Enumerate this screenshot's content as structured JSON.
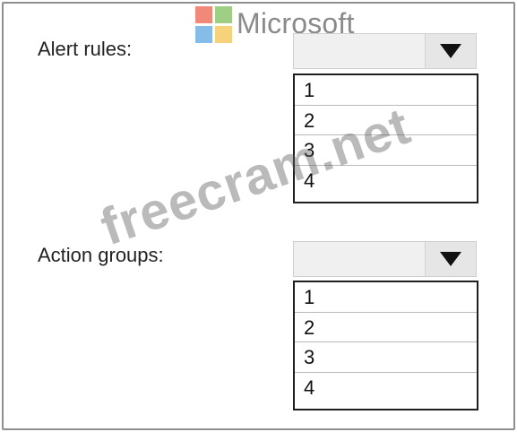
{
  "brand": {
    "name": "Microsoft",
    "logo_colors": {
      "red": "#f1897b",
      "green": "#9fcf85",
      "blue": "#86bde8",
      "yellow": "#f6d27a"
    }
  },
  "watermark": "freecram.net",
  "alert_rules": {
    "label": "Alert rules:",
    "selected": "",
    "arrow_icon": "triangle-down",
    "options": [
      "1",
      "2",
      "3",
      "4"
    ]
  },
  "action_groups": {
    "label": "Action groups:",
    "selected": "",
    "arrow_icon": "triangle-down",
    "options": [
      "1",
      "2",
      "3",
      "4"
    ]
  }
}
